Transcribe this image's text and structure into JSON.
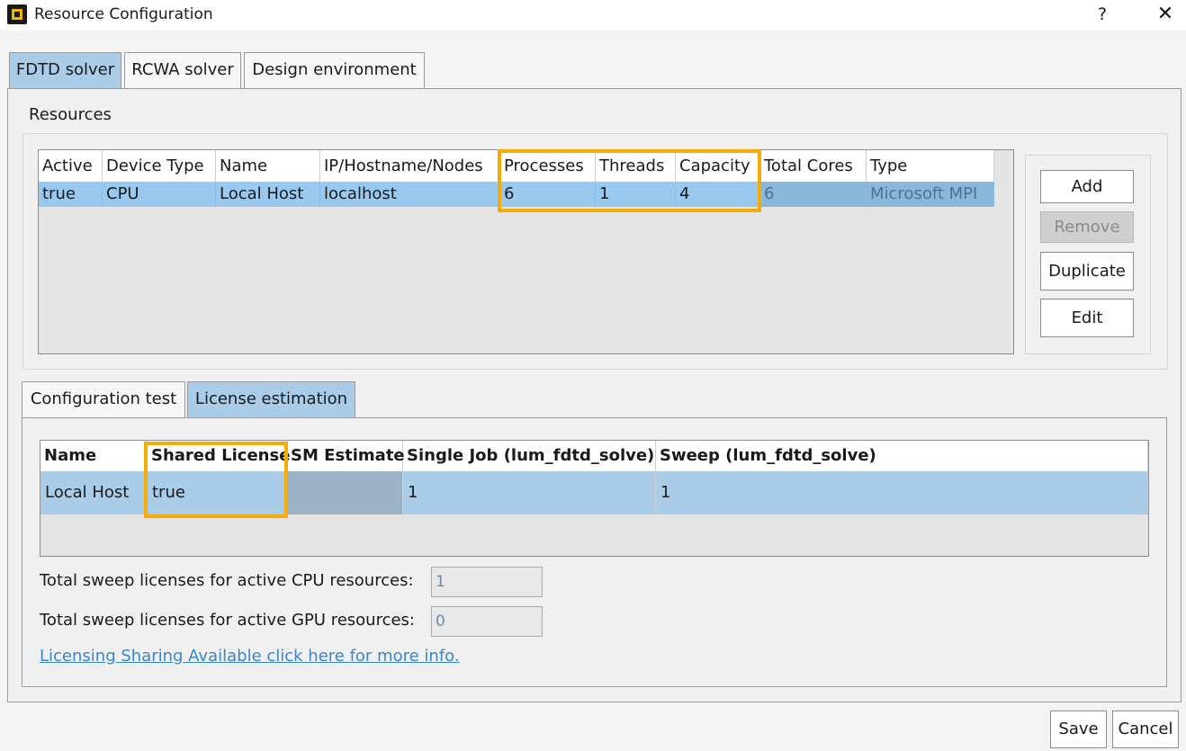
{
  "window": {
    "title": "Resource Configuration",
    "help": "?",
    "close": "✕"
  },
  "tabs": [
    "FDTD solver",
    "RCWA solver",
    "Design environment"
  ],
  "resources": {
    "label": "Resources",
    "columns": [
      "Active",
      "Device Type",
      "Name",
      "IP/Hostname/Nodes",
      "Processes",
      "Threads",
      "Capacity",
      "Total Cores",
      "Type"
    ],
    "rows": [
      [
        "true",
        "CPU",
        "Local Host",
        "localhost",
        "6",
        "1",
        "4",
        "6",
        "Microsoft MPI"
      ]
    ]
  },
  "buttons": {
    "add": "Add",
    "remove": "Remove",
    "duplicate": "Duplicate",
    "edit": "Edit",
    "save": "Save",
    "cancel": "Cancel"
  },
  "inner_tabs": [
    "Configuration test",
    "License estimation"
  ],
  "license": {
    "columns": [
      "Name",
      "Shared License",
      "SM Estimate",
      "Single Job (lum_fdtd_solve)",
      "Sweep (lum_fdtd_solve)"
    ],
    "rows": [
      [
        "Local Host",
        "true",
        "",
        "1",
        "1"
      ]
    ],
    "cpu_label": "Total sweep licenses for active CPU resources:",
    "cpu_value": "1",
    "gpu_label": "Total sweep licenses for active GPU resources:",
    "gpu_value": "0",
    "link": "Licensing Sharing Available click here for more info."
  },
  "colors": {
    "highlight": "#f5ab00",
    "selection": "#99c9ee",
    "active_tab": "#a9cde8"
  }
}
